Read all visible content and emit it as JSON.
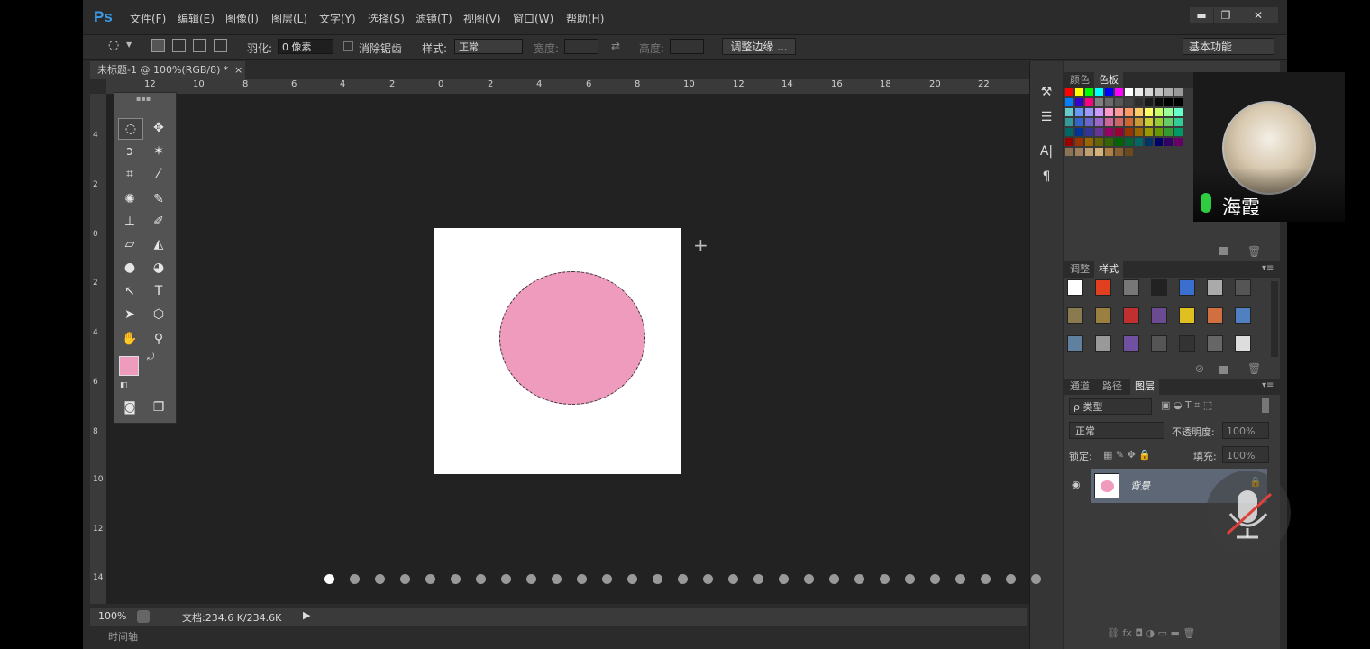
{
  "app": {
    "logo": "Ps",
    "menu": [
      "文件(F)",
      "编辑(E)",
      "图像(I)",
      "图层(L)",
      "文字(Y)",
      "选择(S)",
      "滤镜(T)",
      "视图(V)",
      "窗口(W)",
      "帮助(H)"
    ],
    "window_controls": {
      "minimize": "▬",
      "restore": "❐",
      "close": "✕"
    }
  },
  "options": {
    "feather_label": "羽化:",
    "feather_value": "0 像素",
    "antialias_label": "消除锯齿",
    "style_label": "样式:",
    "style_value": "正常",
    "width_label": "宽度:",
    "height_label": "高度:",
    "refine_button": "调整边缘 ...",
    "workspace": "基本功能"
  },
  "document": {
    "tab_title": "未标题-1 @ 100%(RGB/8) *",
    "tab_close": "×",
    "fill_color": "#ef9bbd",
    "ruler_h": [
      "12",
      "10",
      "8",
      "6",
      "4",
      "2",
      "0",
      "2",
      "4",
      "6",
      "8",
      "10",
      "12",
      "14",
      "16",
      "18",
      "20",
      "22"
    ],
    "ruler_v": [
      "4",
      "2",
      "0",
      "2",
      "4",
      "6",
      "8",
      "10",
      "12",
      "14"
    ]
  },
  "status": {
    "zoom": "100%",
    "doc_info": "文档:234.6 K/234.6K",
    "timeline_label": "时间轴"
  },
  "panels": {
    "color_tabs": [
      "颜色",
      "色板"
    ],
    "style_tabs": [
      "调整",
      "样式"
    ],
    "layer_tabs": [
      "通道",
      "路径",
      "图层"
    ],
    "filter_kind": "ρ 类型",
    "blend_mode": "正常",
    "opacity_label": "不透明度:",
    "opacity_value": "100%",
    "lock_label": "锁定:",
    "fill_label": "填充:",
    "fill_value": "100%",
    "layer_name": "背景"
  },
  "overlay": {
    "participant_name": "海霞",
    "page_dots_count": 29,
    "page_dots_active": 1
  },
  "colors": {
    "foreground": "#ef9bbd",
    "background": "#ffffff",
    "accent": "#3d9ae8"
  }
}
